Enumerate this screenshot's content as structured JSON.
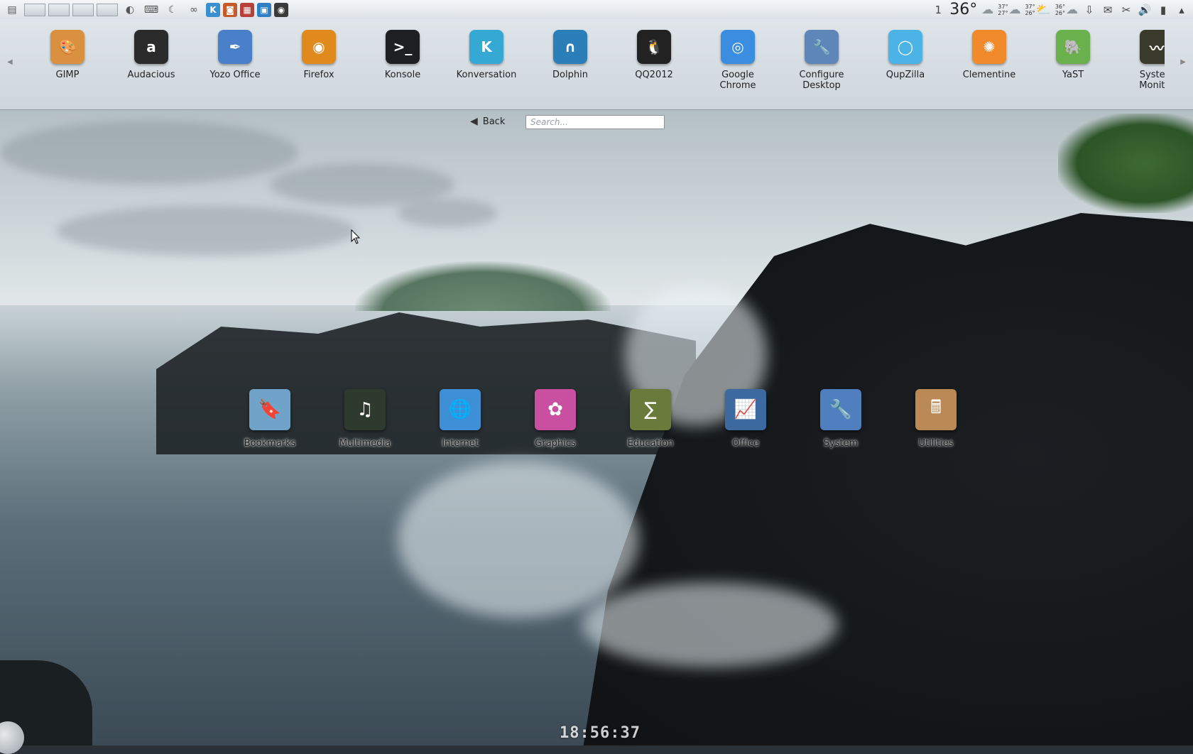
{
  "panel": {
    "temperature": "36°",
    "forecast": [
      {
        "high": "37°",
        "low": "27°",
        "icon": "cloud-icon"
      },
      {
        "high": "37°",
        "low": "26°",
        "icon": "sun-cloud-icon"
      },
      {
        "high": "36°",
        "low": "26°",
        "icon": "cloud-icon"
      }
    ],
    "notification_count": "1"
  },
  "launcher": {
    "apps": [
      {
        "label": "GIMP",
        "icon": "gimp-icon",
        "color": "#d9903f",
        "glyph": "🎨"
      },
      {
        "label": "Audacious",
        "icon": "audacious-icon",
        "color": "#2b2b2b",
        "glyph": "a"
      },
      {
        "label": "Yozo Office",
        "icon": "yozo-office-icon",
        "color": "#4a7fc9",
        "glyph": "✒"
      },
      {
        "label": "Firefox",
        "icon": "firefox-icon",
        "color": "#e08a1e",
        "glyph": "◉"
      },
      {
        "label": "Konsole",
        "icon": "konsole-icon",
        "color": "#1d1f22",
        "glyph": ">_"
      },
      {
        "label": "Konversation",
        "icon": "konversation-icon",
        "color": "#35a8d4",
        "glyph": "K"
      },
      {
        "label": "Dolphin",
        "icon": "dolphin-icon",
        "color": "#2a7fb8",
        "glyph": "∩"
      },
      {
        "label": "QQ2012",
        "icon": "qq-penguin-icon",
        "color": "#222222",
        "glyph": "🐧"
      },
      {
        "label": "Google\nChrome",
        "icon": "chrome-icon",
        "color": "#3b8de0",
        "glyph": "◎"
      },
      {
        "label": "Configure\nDesktop",
        "icon": "configure-desktop-icon",
        "color": "#5f86b8",
        "glyph": "🔧"
      },
      {
        "label": "QupZilla",
        "icon": "qupzilla-icon",
        "color": "#4bb3e6",
        "glyph": "◯"
      },
      {
        "label": "Clementine",
        "icon": "clementine-icon",
        "color": "#f08a2a",
        "glyph": "✺"
      },
      {
        "label": "YaST",
        "icon": "yast-icon",
        "color": "#6ab04c",
        "glyph": "🐘"
      },
      {
        "label": "System\nMonitor",
        "icon": "system-monitor-icon",
        "color": "#3a3a2a",
        "glyph": "〰"
      }
    ]
  },
  "nav": {
    "back_label": "Back",
    "search_placeholder": "Search..."
  },
  "categories": [
    {
      "label": "Bookmarks",
      "icon": "bookmarks-folder-icon",
      "color": "#6fa3c9",
      "glyph": "🔖"
    },
    {
      "label": "Multimedia",
      "icon": "multimedia-icon",
      "color": "#2e3a2e",
      "glyph": "♫"
    },
    {
      "label": "Internet",
      "icon": "internet-globe-icon",
      "color": "#3f8fd6",
      "glyph": "🌐"
    },
    {
      "label": "Graphics",
      "icon": "graphics-color-wheel-icon",
      "color": "#c94fa0",
      "glyph": "✿"
    },
    {
      "label": "Education",
      "icon": "education-chalkboard-icon",
      "color": "#6a7a3a",
      "glyph": "∑"
    },
    {
      "label": "Office",
      "icon": "office-chart-icon",
      "color": "#3c6aa0",
      "glyph": "📈"
    },
    {
      "label": "System",
      "icon": "system-wrench-icon",
      "color": "#4f7fbf",
      "glyph": "🔧"
    },
    {
      "label": "Utilities",
      "icon": "utilities-calculator-icon",
      "color": "#b98a55",
      "glyph": "🖩"
    }
  ],
  "clock": "18:56:37"
}
